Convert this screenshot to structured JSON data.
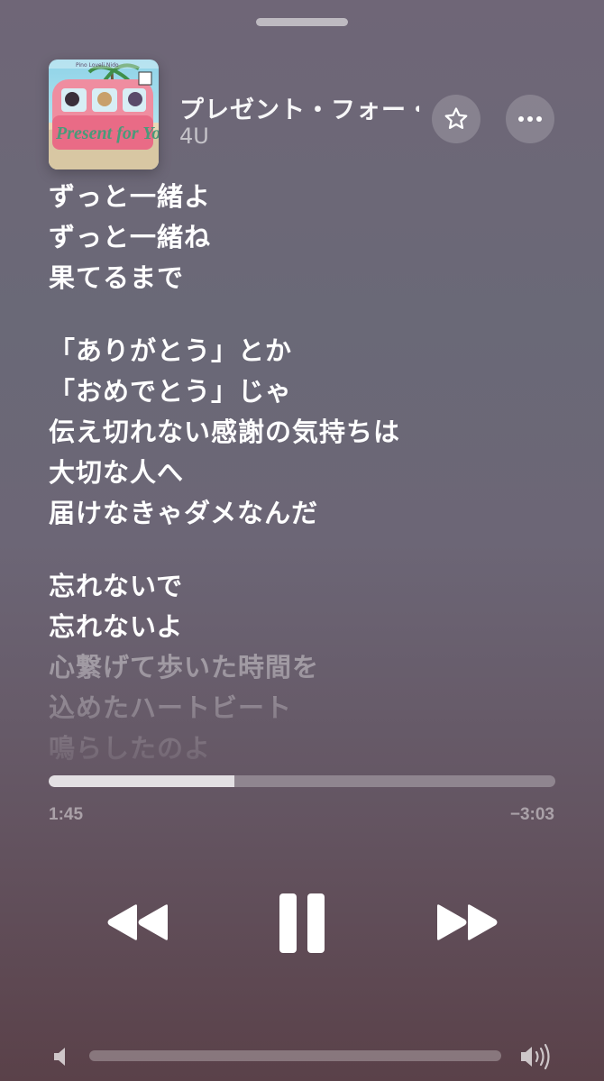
{
  "now_playing": {
    "title": "プレゼント・フォー・ユー",
    "artist": "4U",
    "artwork_text": "Present for You",
    "artwork_label": "Pino Loveli Nido"
  },
  "icons": {
    "favorite": "star-icon",
    "more": "ellipsis-icon",
    "rewind": "rewind-icon",
    "pause": "pause-icon",
    "fast_forward": "fast-forward-icon",
    "volume_low": "speaker-low-icon",
    "volume_high": "speaker-high-icon"
  },
  "lyrics": [
    {
      "text": "ずっと一緒よ",
      "state": "active"
    },
    {
      "text": "ずっと一緒ね",
      "state": "active"
    },
    {
      "text": "果てるまで",
      "state": "active"
    },
    {
      "text": "",
      "state": "gap"
    },
    {
      "text": "「ありがとう」とか",
      "state": "active"
    },
    {
      "text": "「おめでとう」じゃ",
      "state": "active"
    },
    {
      "text": "伝え切れない感謝の気持ちは",
      "state": "active"
    },
    {
      "text": "大切な人へ",
      "state": "active"
    },
    {
      "text": "届けなきゃダメなんだ",
      "state": "active"
    },
    {
      "text": "",
      "state": "gap"
    },
    {
      "text": "忘れないで",
      "state": "active"
    },
    {
      "text": "忘れないよ",
      "state": "active"
    },
    {
      "text": "心繋げて歩いた時間を",
      "state": "upcoming"
    },
    {
      "text": "込めたハートビート",
      "state": "upcoming"
    },
    {
      "text": "鳴らしたのよ",
      "state": "upcoming"
    }
  ],
  "playback": {
    "elapsed": "1:45",
    "remaining": "−3:03",
    "progress_fraction": 0.366
  },
  "volume": {
    "level_fraction": 0.0
  },
  "colors": {
    "background_top": "#6f6677",
    "background_bottom": "#5a4149",
    "text_primary": "#ffffff"
  }
}
